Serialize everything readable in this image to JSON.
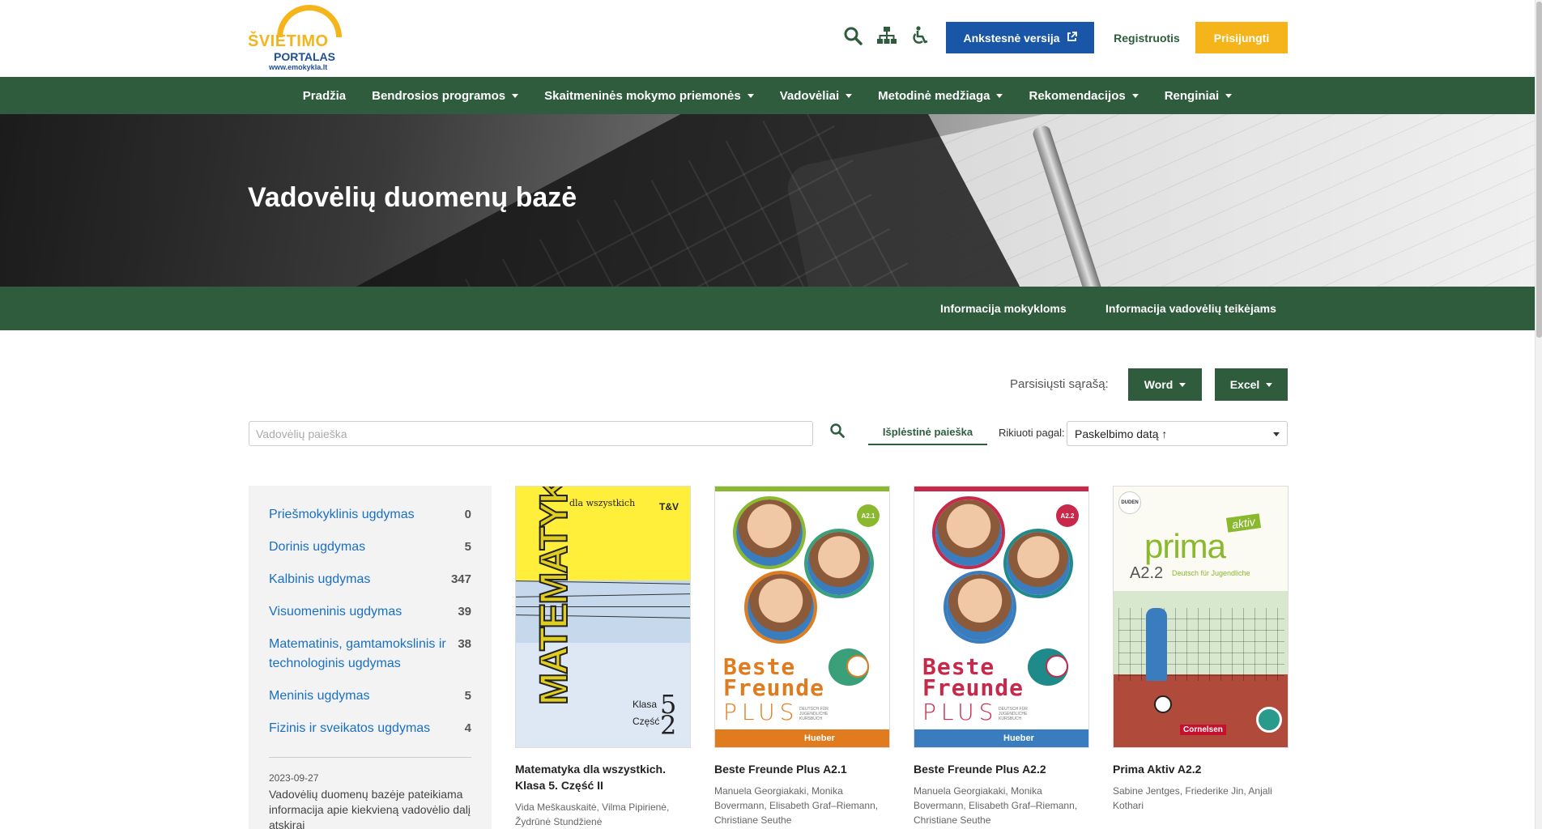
{
  "logo": {
    "line1": "ŠVIETIMO",
    "line2": "PORTALAS",
    "line3": "www.emokykla.lt"
  },
  "header": {
    "icons": [
      "search-icon",
      "sitemap-icon",
      "accessibility-icon"
    ],
    "old_version": "Ankstesnė versija",
    "register": "Registruotis",
    "login": "Prisijungti"
  },
  "nav": {
    "items": [
      {
        "label": "Pradžia",
        "dropdown": false
      },
      {
        "label": "Bendrosios programos",
        "dropdown": true
      },
      {
        "label": "Skaitmeninės mokymo priemonės",
        "dropdown": true
      },
      {
        "label": "Vadovėliai",
        "dropdown": true
      },
      {
        "label": "Metodinė medžiaga",
        "dropdown": true
      },
      {
        "label": "Rekomendacijos",
        "dropdown": true
      },
      {
        "label": "Renginiai",
        "dropdown": true
      }
    ]
  },
  "hero": {
    "title": "Vadovėlių duomenų bazė"
  },
  "subnav": {
    "schools": "Informacija mokykloms",
    "suppliers": "Informacija vadovėlių teikėjams"
  },
  "download": {
    "label": "Parsisiųsti sąrašą:",
    "word": "Word",
    "excel": "Excel"
  },
  "search": {
    "placeholder": "Vadovėlių paieška",
    "advanced": "Išplėstinė paieška",
    "sort_label": "Rikiuoti pagal:",
    "sort_value": "Paskelbimo datą ↑"
  },
  "sidebar": {
    "categories": [
      {
        "name": "Priešmokyklinis ugdymas",
        "count": "0"
      },
      {
        "name": "Dorinis ugdymas",
        "count": "5"
      },
      {
        "name": "Kalbinis ugdymas",
        "count": "347"
      },
      {
        "name": "Visuomeninis ugdymas",
        "count": "39"
      },
      {
        "name": "Matematinis, gamtamokslinis ir technologinis ugdymas",
        "count": "38"
      },
      {
        "name": "Meninis ugdymas",
        "count": "5"
      },
      {
        "name": "Fizinis ir sveikatos ugdymas",
        "count": "4"
      }
    ],
    "news_date": "2023-09-27",
    "news_text": "Vadovėlių duomenų bazėje pateikiama informacija apie kiekvieną vadovėlio dalį atskirai"
  },
  "books": [
    {
      "title": "Matematyka dla wszystkich. Klasa 5. Część II",
      "authors": "Vida Meškauskaitė, Vilma Pipirienė, Žydrūnė Stundžienė",
      "cover": {
        "title": "MATEMATYKA",
        "subtitle": "dla wszystkich",
        "publisher": "T&V",
        "klasa": "Klasa",
        "czesc": "Część",
        "n1": "5",
        "n2": "2"
      }
    },
    {
      "title": "Beste Freunde Plus A2.1",
      "authors": "Manuela Georgiakaki, Monika Bovermann, Elisabeth Graf–Riemann, Christiane Seuthe",
      "cover": {
        "badge": "A2.1",
        "beste": "Beste",
        "freunde": "Freunde",
        "plus": "PLUS",
        "kurs": "DEUTSCH FÜR JUGENDLICHE KURSBUCH",
        "publisher": "Hueber",
        "accent": "#8ab82f"
      }
    },
    {
      "title": "Beste Freunde Plus A2.2",
      "authors": "Manuela Georgiakaki, Monika Bovermann, Elisabeth Graf–Riemann, Christiane Seuthe",
      "cover": {
        "badge": "A2.2",
        "beste": "Beste",
        "freunde": "Freunde",
        "plus": "PLUS",
        "kurs": "DEUTSCH FÜR JUGENDLICHE KURSBUCH",
        "publisher": "Hueber",
        "accent": "#c8284a"
      }
    },
    {
      "title": "Prima Aktiv A2.2",
      "authors": "Sabine Jentges, Friederike Jin, Anjali Kothari",
      "cover": {
        "prima": "prima",
        "aktiv": "aktiv",
        "level": "A2.2",
        "subtitle": "Deutsch für Jugendliche",
        "duden": "DUDEN",
        "publisher": "Cornelsen"
      }
    }
  ],
  "colors": {
    "green": "#2e5c3c",
    "blue": "#1a56a8",
    "yellow": "#f4b41a",
    "link": "#1a6fc4"
  }
}
